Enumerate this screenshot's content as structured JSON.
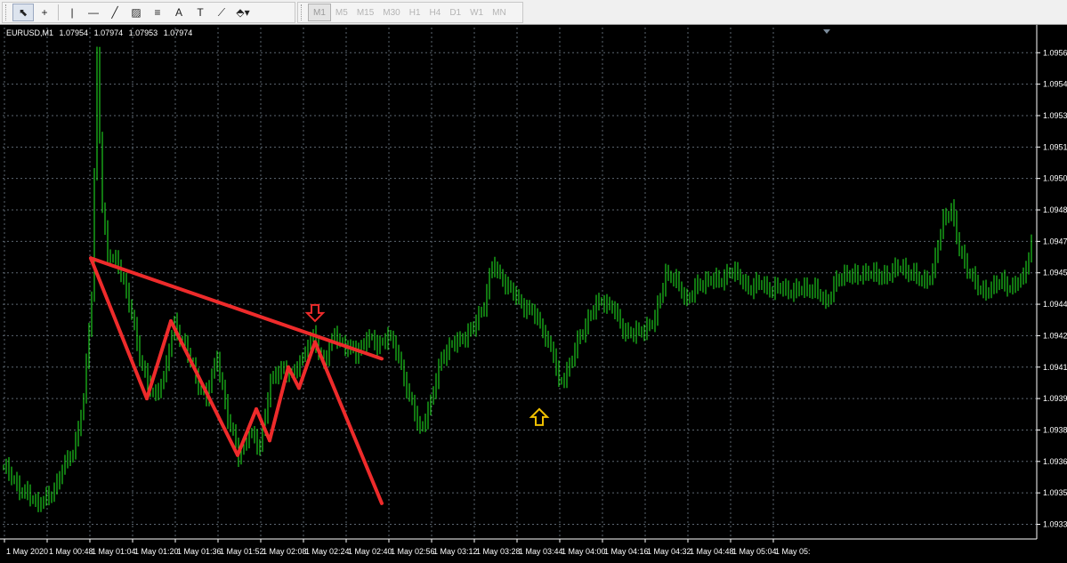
{
  "toolbar": {
    "tools": [
      {
        "name": "cursor-tool",
        "glyph": "⬉",
        "active": true
      },
      {
        "name": "crosshair-tool",
        "glyph": "+",
        "active": false
      },
      {
        "sep": true
      },
      {
        "name": "vertical-line-tool",
        "glyph": "|",
        "active": false
      },
      {
        "name": "horizontal-line-tool",
        "glyph": "—",
        "active": false
      },
      {
        "name": "trendline-tool",
        "glyph": "╱",
        "active": false
      },
      {
        "name": "equidistant-channel-tool",
        "glyph": "▨",
        "active": false
      },
      {
        "name": "fibonacci-tool",
        "glyph": "≡",
        "active": false
      },
      {
        "name": "text-tool",
        "glyph": "A",
        "active": false
      },
      {
        "name": "text-label-tool",
        "glyph": "T",
        "active": false
      },
      {
        "name": "fibo-fan-tool",
        "glyph": "⟋",
        "active": false
      },
      {
        "name": "arrows-tool",
        "glyph": "⬘▾",
        "active": false
      }
    ],
    "timeframes": [
      {
        "label": "M1",
        "active": true
      },
      {
        "label": "M5",
        "active": false
      },
      {
        "label": "M15",
        "active": false
      },
      {
        "label": "M30",
        "active": false
      },
      {
        "label": "H1",
        "active": false
      },
      {
        "label": "H4",
        "active": false
      },
      {
        "label": "D1",
        "active": false
      },
      {
        "label": "W1",
        "active": false
      },
      {
        "label": "MN",
        "active": false
      }
    ]
  },
  "chart": {
    "symbol": "EURUSD,M1",
    "open": "1.07954",
    "high": "1.07974",
    "low": "1.07953",
    "close": "1.07974",
    "colors": {
      "background": "#000000",
      "grid": "#5c6670",
      "candles": "#22ee22",
      "axis_text": "#ffffff",
      "annotation": "#ee2b2b",
      "down_arrow": "#ee2b2b",
      "up_arrow": "#f0c000"
    },
    "price_labels": [
      "1.09560",
      "1.09545",
      "1.09530",
      "1.09515",
      "1.09500",
      "1.09485",
      "1.09470",
      "1.09455",
      "1.09440",
      "1.09425",
      "1.09410",
      "1.09395",
      "1.09380",
      "1.09365",
      "1.09350",
      "1.09335"
    ],
    "time_labels": [
      "1 May 2020",
      "1 May 00:48",
      "1 May 01:04",
      "1 May 01:20",
      "1 May 01:36",
      "1 May 01:52",
      "1 May 02:08",
      "1 May 02:24",
      "1 May 02:40",
      "1 May 02:56",
      "1 May 03:12",
      "1 May 03:28",
      "1 May 03:44",
      "1 May 04:00",
      "1 May 04:16",
      "1 May 04:32",
      "1 May 04:48",
      "1 May 05:04",
      "1 May 05:"
    ]
  },
  "chart_data": {
    "type": "line",
    "ylim": [
      1.09328,
      1.09572
    ],
    "y_ticks": [
      1.0956,
      1.09545,
      1.0953,
      1.09515,
      1.095,
      1.09485,
      1.0947,
      1.09455,
      1.0944,
      1.09425,
      1.0941,
      1.09395,
      1.0938,
      1.09365,
      1.0935,
      1.09335
    ],
    "x_ticks": [
      "1 May 2020",
      "1 May 00:48",
      "1 May 01:04",
      "1 May 01:20",
      "1 May 01:36",
      "1 May 01:52",
      "1 May 02:08",
      "1 May 02:24",
      "1 May 02:40",
      "1 May 02:56",
      "1 May 03:12",
      "1 May 03:28",
      "1 May 03:44",
      "1 May 04:00",
      "1 May 04:16",
      "1 May 04:32",
      "1 May 04:48",
      "1 May 05:04",
      "1 May 05:"
    ],
    "price_points": [
      {
        "bar": 0,
        "price": 1.09362
      },
      {
        "bar": 6,
        "price": 1.09352
      },
      {
        "bar": 12,
        "price": 1.09345
      },
      {
        "bar": 18,
        "price": 1.09348
      },
      {
        "bar": 22,
        "price": 1.09362
      },
      {
        "bar": 26,
        "price": 1.09368
      },
      {
        "bar": 30,
        "price": 1.09395
      },
      {
        "bar": 33,
        "price": 1.09443
      },
      {
        "bar": 35,
        "price": 1.09559
      },
      {
        "bar": 37,
        "price": 1.09486
      },
      {
        "bar": 39,
        "price": 1.09462
      },
      {
        "bar": 43,
        "price": 1.0946
      },
      {
        "bar": 47,
        "price": 1.0944
      },
      {
        "bar": 52,
        "price": 1.0941
      },
      {
        "bar": 56,
        "price": 1.09395
      },
      {
        "bar": 60,
        "price": 1.09405
      },
      {
        "bar": 64,
        "price": 1.0943
      },
      {
        "bar": 68,
        "price": 1.0942
      },
      {
        "bar": 72,
        "price": 1.09405
      },
      {
        "bar": 76,
        "price": 1.09395
      },
      {
        "bar": 80,
        "price": 1.09415
      },
      {
        "bar": 84,
        "price": 1.09385
      },
      {
        "bar": 88,
        "price": 1.09368
      },
      {
        "bar": 92,
        "price": 1.09378
      },
      {
        "bar": 96,
        "price": 1.09372
      },
      {
        "bar": 100,
        "price": 1.09402
      },
      {
        "bar": 104,
        "price": 1.0941
      },
      {
        "bar": 108,
        "price": 1.09405
      },
      {
        "bar": 112,
        "price": 1.09415
      },
      {
        "bar": 116,
        "price": 1.09424
      },
      {
        "bar": 120,
        "price": 1.09412
      },
      {
        "bar": 124,
        "price": 1.09425
      },
      {
        "bar": 128,
        "price": 1.0942
      },
      {
        "bar": 132,
        "price": 1.09416
      },
      {
        "bar": 136,
        "price": 1.09424
      },
      {
        "bar": 140,
        "price": 1.0942
      },
      {
        "bar": 144,
        "price": 1.09425
      },
      {
        "bar": 148,
        "price": 1.09415
      },
      {
        "bar": 152,
        "price": 1.09395
      },
      {
        "bar": 156,
        "price": 1.0938
      },
      {
        "bar": 160,
        "price": 1.09392
      },
      {
        "bar": 164,
        "price": 1.09415
      },
      {
        "bar": 168,
        "price": 1.0942
      },
      {
        "bar": 172,
        "price": 1.09424
      },
      {
        "bar": 176,
        "price": 1.09428
      },
      {
        "bar": 180,
        "price": 1.0944
      },
      {
        "bar": 183,
        "price": 1.09458
      },
      {
        "bar": 187,
        "price": 1.09452
      },
      {
        "bar": 190,
        "price": 1.09446
      },
      {
        "bar": 194,
        "price": 1.0944
      },
      {
        "bar": 198,
        "price": 1.09436
      },
      {
        "bar": 202,
        "price": 1.09428
      },
      {
        "bar": 206,
        "price": 1.09415
      },
      {
        "bar": 208,
        "price": 1.09402
      },
      {
        "bar": 212,
        "price": 1.0941
      },
      {
        "bar": 216,
        "price": 1.09425
      },
      {
        "bar": 220,
        "price": 1.09435
      },
      {
        "bar": 224,
        "price": 1.09442
      },
      {
        "bar": 228,
        "price": 1.09438
      },
      {
        "bar": 232,
        "price": 1.09428
      },
      {
        "bar": 236,
        "price": 1.09425
      },
      {
        "bar": 240,
        "price": 1.09428
      },
      {
        "bar": 244,
        "price": 1.09432
      },
      {
        "bar": 248,
        "price": 1.09455
      },
      {
        "bar": 252,
        "price": 1.0945
      },
      {
        "bar": 256,
        "price": 1.09442
      },
      {
        "bar": 260,
        "price": 1.09448
      },
      {
        "bar": 264,
        "price": 1.09452
      },
      {
        "bar": 268,
        "price": 1.0945
      },
      {
        "bar": 272,
        "price": 1.09456
      },
      {
        "bar": 276,
        "price": 1.09452
      },
      {
        "bar": 280,
        "price": 1.09447
      },
      {
        "bar": 284,
        "price": 1.0945
      },
      {
        "bar": 288,
        "price": 1.09446
      },
      {
        "bar": 292,
        "price": 1.09448
      },
      {
        "bar": 296,
        "price": 1.09445
      },
      {
        "bar": 300,
        "price": 1.09448
      },
      {
        "bar": 304,
        "price": 1.09446
      },
      {
        "bar": 308,
        "price": 1.09441
      },
      {
        "bar": 312,
        "price": 1.0945
      },
      {
        "bar": 316,
        "price": 1.09455
      },
      {
        "bar": 320,
        "price": 1.09452
      },
      {
        "bar": 324,
        "price": 1.09456
      },
      {
        "bar": 328,
        "price": 1.09452
      },
      {
        "bar": 332,
        "price": 1.09455
      },
      {
        "bar": 336,
        "price": 1.09457
      },
      {
        "bar": 340,
        "price": 1.09455
      },
      {
        "bar": 344,
        "price": 1.0945
      },
      {
        "bar": 348,
        "price": 1.09455
      },
      {
        "bar": 352,
        "price": 1.0948
      },
      {
        "bar": 355,
        "price": 1.09486
      },
      {
        "bar": 358,
        "price": 1.09465
      },
      {
        "bar": 362,
        "price": 1.09455
      },
      {
        "bar": 366,
        "price": 1.09445
      },
      {
        "bar": 370,
        "price": 1.09448
      },
      {
        "bar": 374,
        "price": 1.0945
      },
      {
        "bar": 378,
        "price": 1.09448
      },
      {
        "bar": 382,
        "price": 1.09452
      },
      {
        "bar": 385,
        "price": 1.0947
      }
    ],
    "annotation_lines": [
      {
        "from": {
          "bar": 33,
          "price": 1.09462
        },
        "to": {
          "bar": 142,
          "price": 1.09414
        }
      },
      {
        "from": {
          "bar": 33,
          "price": 1.09462
        },
        "to": {
          "bar": 54,
          "price": 1.09395
        }
      },
      {
        "from": {
          "bar": 54,
          "price": 1.09395
        },
        "to": {
          "bar": 63,
          "price": 1.09432
        }
      },
      {
        "from": {
          "bar": 63,
          "price": 1.09432
        },
        "to": {
          "bar": 88,
          "price": 1.09368
        }
      },
      {
        "from": {
          "bar": 88,
          "price": 1.09368
        },
        "to": {
          "bar": 95,
          "price": 1.0939
        }
      },
      {
        "from": {
          "bar": 95,
          "price": 1.0939
        },
        "to": {
          "bar": 100,
          "price": 1.09375
        }
      },
      {
        "from": {
          "bar": 100,
          "price": 1.09375
        },
        "to": {
          "bar": 107,
          "price": 1.0941
        }
      },
      {
        "from": {
          "bar": 107,
          "price": 1.0941
        },
        "to": {
          "bar": 111,
          "price": 1.094
        }
      },
      {
        "from": {
          "bar": 111,
          "price": 1.094
        },
        "to": {
          "bar": 117,
          "price": 1.09422
        }
      },
      {
        "from": {
          "bar": 117,
          "price": 1.09422
        },
        "to": {
          "bar": 142,
          "price": 1.09345
        }
      }
    ],
    "markers": [
      {
        "type": "arrow-down",
        "bar": 117,
        "price": 1.09432,
        "color": "#ee2b2b"
      },
      {
        "type": "arrow-up",
        "bar": 201,
        "price": 1.0939,
        "color": "#f0c000"
      }
    ]
  }
}
